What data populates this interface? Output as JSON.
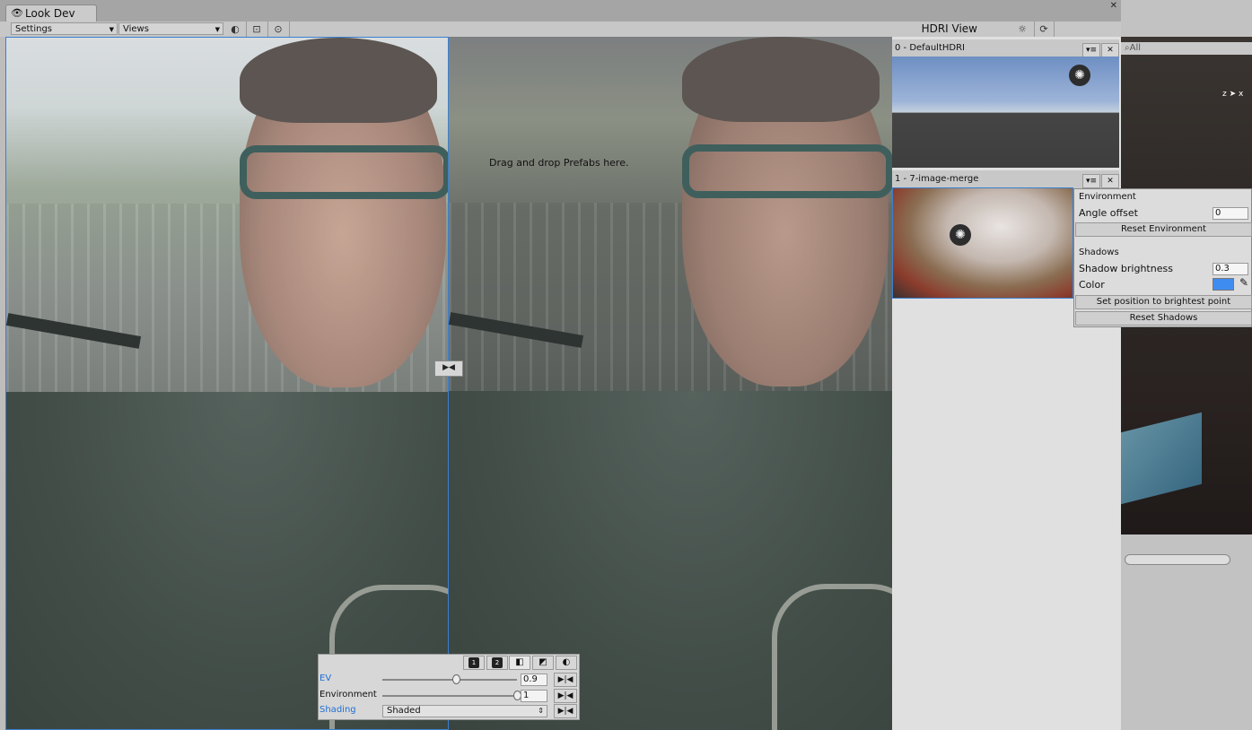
{
  "window": {
    "tab_title": "Look Dev"
  },
  "toolbar": {
    "settings_label": "Settings",
    "views_label": "Views",
    "hdri_view_label": "HDRI View"
  },
  "viewport": {
    "drop_hint": "Drag and drop Prefabs here."
  },
  "controls": {
    "mode_buttons": [
      "1",
      "2",
      "",
      "",
      ""
    ],
    "ev_label": "EV",
    "ev_value": "0.9",
    "ev_slider_fraction": 0.55,
    "environment_label": "Environment",
    "environment_value": "1",
    "environment_slider_fraction": 1.0,
    "shading_label": "Shading",
    "shading_value": "Shaded"
  },
  "hdri_list": {
    "items": [
      {
        "title": "0 - DefaultHDRI"
      },
      {
        "title": "1 - 7-image-merge"
      }
    ]
  },
  "env_popup": {
    "environment_heading": "Environment",
    "angle_offset_label": "Angle offset",
    "angle_offset_value": "0",
    "reset_environment_label": "Reset Environment",
    "shadows_heading": "Shadows",
    "shadow_brightness_label": "Shadow brightness",
    "shadow_brightness_value": "0.3",
    "color_label": "Color",
    "shadow_color": "#3f8cf1",
    "set_position_label": "Set position to brightest point",
    "reset_shadows_label": "Reset Shadows"
  },
  "scene": {
    "search_placeholder": "All"
  },
  "colors": {
    "accent": "#3b7fd0",
    "label_blue": "#1f6fd6"
  }
}
